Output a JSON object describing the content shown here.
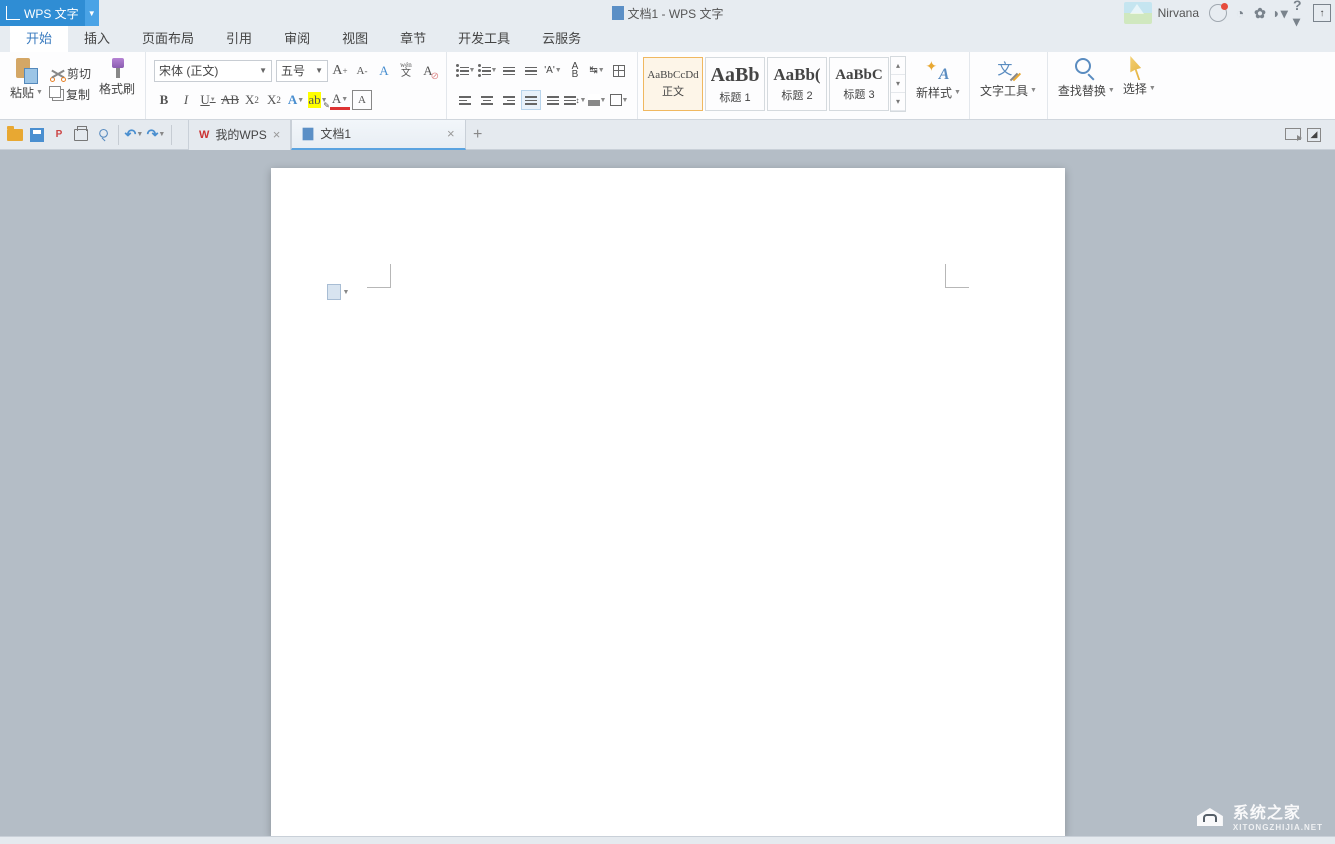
{
  "app": {
    "name": "WPS 文字",
    "doc_title": "文档1 - WPS 文字"
  },
  "user": {
    "name": "Nirvana"
  },
  "menu": [
    "开始",
    "插入",
    "页面布局",
    "引用",
    "审阅",
    "视图",
    "章节",
    "开发工具",
    "云服务"
  ],
  "ribbon": {
    "clipboard": {
      "paste": "粘贴",
      "cut": "剪切",
      "copy": "复制",
      "brush": "格式刷"
    },
    "font": {
      "name": "宋体 (正文)",
      "size": "五号"
    },
    "styles": [
      {
        "name": "正文",
        "preview": "AaBbCcDd",
        "fs": "11px",
        "fw": "normal"
      },
      {
        "name": "标题 1",
        "preview": "AaBb",
        "fs": "20px",
        "fw": "bold"
      },
      {
        "name": "标题 2",
        "preview": "AaBb(",
        "fs": "17px",
        "fw": "bold"
      },
      {
        "name": "标题 3",
        "preview": "AaBbC",
        "fs": "15px",
        "fw": "bold"
      }
    ],
    "newstyle": "新样式",
    "texttool": "文字工具",
    "find": "查找替换",
    "select": "选择"
  },
  "doc_tabs": [
    {
      "label": "我的WPS",
      "wps": true
    },
    {
      "label": "文档1",
      "active": true
    }
  ],
  "watermark": {
    "title": "系统之家",
    "sub": "XITONGZHIJIA.NET"
  }
}
